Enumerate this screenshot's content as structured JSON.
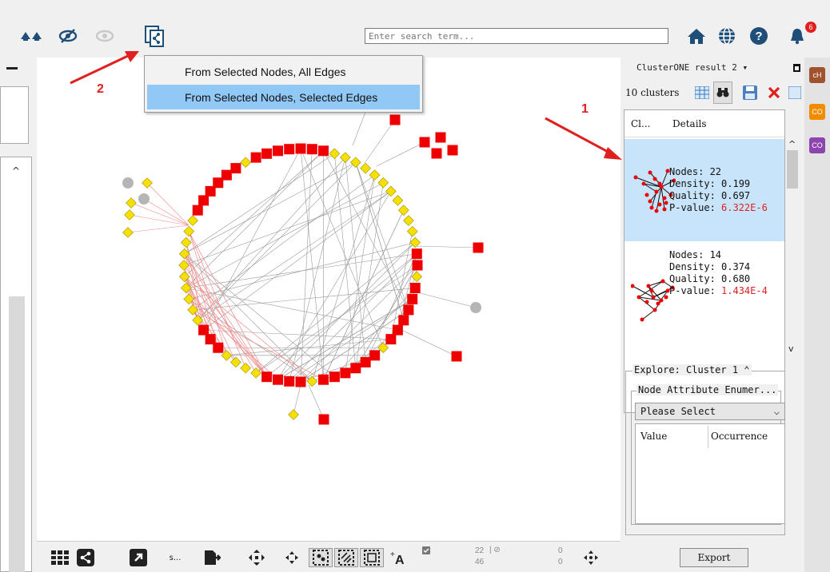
{
  "toolbar": {
    "search_placeholder": "Enter search term...",
    "notification_count": "6"
  },
  "menu": {
    "items": [
      {
        "label": "From Selected Nodes, All Edges"
      },
      {
        "label": "From Selected Nodes, Selected Edges"
      }
    ]
  },
  "annotations": {
    "one": "1",
    "two": "2"
  },
  "right_panel": {
    "title": "ClusterONE result 2 ▾",
    "clusters_count": "10 clusters",
    "columns": {
      "cluster": "Cl...",
      "details": "Details"
    },
    "clusters": [
      {
        "nodes": "Nodes: 22",
        "density": "Density: 0.199",
        "quality": "Quality: 0.697",
        "pvalue_label": "P-value: ",
        "pvalue": "6.322E-6"
      },
      {
        "nodes": "Nodes: 14",
        "density": "Density: 0.374",
        "quality": "Quality: 0.680",
        "pvalue_label": "P-value: ",
        "pvalue": "1.434E-4"
      }
    ],
    "explore_title": "Explore: Cluster 1 ⌃",
    "node_attr_title": "Node Attribute Enumer...",
    "select_value": "Please Select",
    "value_header": "Value",
    "occurrence_header": "Occurrence",
    "export_label": "Export"
  },
  "side_tabs": [
    "cH",
    "CO",
    "CO"
  ],
  "side_tab_colors": [
    "#a0522d",
    "#f08c00",
    "#8e44ad"
  ],
  "bottom_bar": {
    "s_label": "s...",
    "selected_nodes": "22",
    "selected_edges": "46",
    "hidden_nodes": "0",
    "hidden_edges": "0"
  },
  "network_colors": {
    "selected": "#ee0000",
    "cluster": "#f6e000",
    "outside": "#b5b5b5"
  }
}
